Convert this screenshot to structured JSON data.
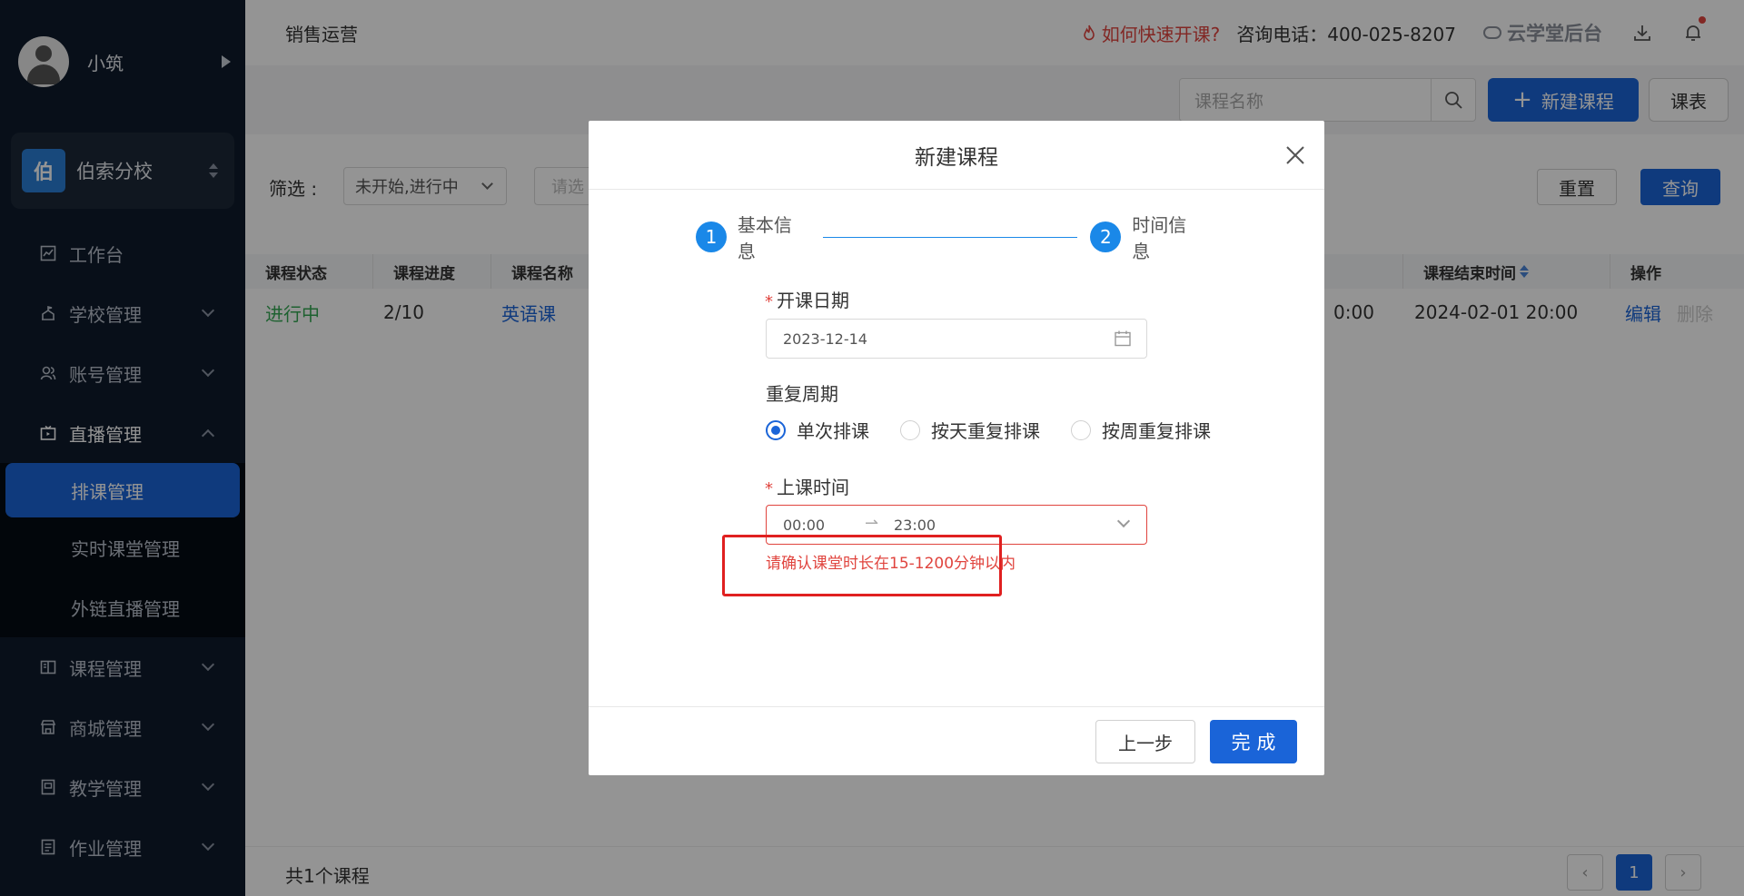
{
  "sidebar": {
    "user_name": "小筑",
    "school_logo": "伯",
    "school_name": "伯索分校",
    "items": [
      {
        "label": "工作台",
        "icon": "dashboard-icon"
      },
      {
        "label": "学校管理",
        "icon": "school-icon"
      },
      {
        "label": "账号管理",
        "icon": "users-icon"
      },
      {
        "label": "直播管理",
        "icon": "live-icon"
      },
      {
        "label": "课程管理",
        "icon": "book-icon"
      },
      {
        "label": "商城管理",
        "icon": "shop-icon"
      },
      {
        "label": "教学管理",
        "icon": "teach-icon"
      },
      {
        "label": "作业管理",
        "icon": "homework-icon"
      }
    ],
    "live_sub": [
      {
        "label": "排课管理",
        "active": true
      },
      {
        "label": "实时课堂管理",
        "active": false
      },
      {
        "label": "外链直播管理",
        "active": false
      }
    ]
  },
  "topbar": {
    "title": "销售运营",
    "quick_link": "如何快速开课?",
    "hotline": "咨询电话：400-025-8207",
    "brand": "云学堂后台"
  },
  "toolbar": {
    "search_placeholder": "课程名称",
    "new_course": "新建课程",
    "schedule": "课表"
  },
  "filter": {
    "label": "筛选 :",
    "status_value": "未开始,进行中",
    "input_placeholder": "请选",
    "reset": "重置",
    "query": "查询"
  },
  "table": {
    "headers": [
      "课程状态",
      "课程进度",
      "课程名称",
      "课程结束时间",
      "操作"
    ],
    "row": {
      "status": "进行中",
      "progress": "2/10",
      "name": "英语课",
      "start_fragment": "0:00",
      "end_time": "2024-02-01 20:00",
      "edit": "编辑",
      "delete": "删除"
    }
  },
  "footer": {
    "count": "共1个课程",
    "page": "1"
  },
  "modal": {
    "title": "新建课程",
    "step1_num": "1",
    "step1_label": "基本信息",
    "step2_num": "2",
    "step2_label": "时间信息",
    "start_date_label": "开课日期",
    "start_date_value": "2023-12-14",
    "repeat_label": "重复周期",
    "repeat_options": [
      "单次排课",
      "按天重复排课",
      "按周重复排课"
    ],
    "repeat_selected": "单次排课",
    "class_time_label": "上课时间",
    "time_start": "00:00",
    "time_end": "23:00",
    "error": "请确认课堂时长在15-1200分钟以内",
    "prev": "上一步",
    "done": "完 成"
  },
  "colors": {
    "primary": "#1a64d8",
    "sidebar_bg": "#0e1a2b",
    "error": "#e0443e",
    "status_green": "#34a853"
  }
}
